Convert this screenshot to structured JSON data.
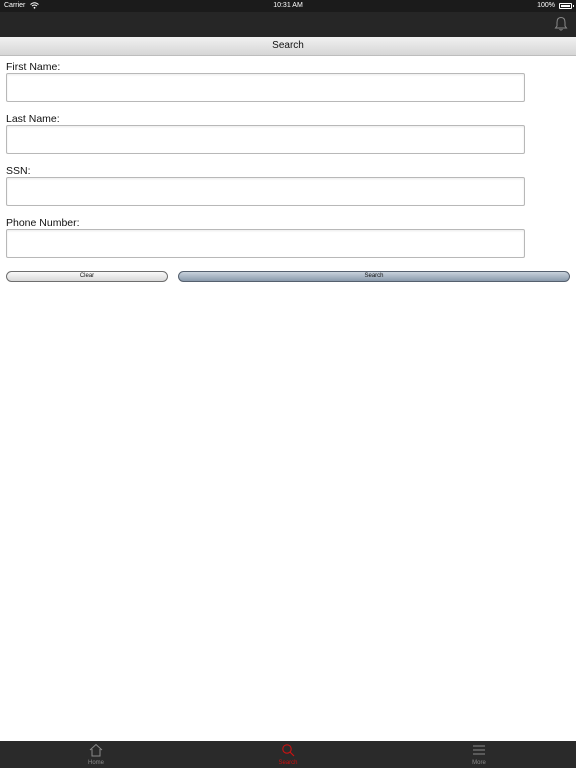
{
  "status_bar": {
    "carrier": "Carrier",
    "time": "10:31 AM",
    "battery_pct": "100%"
  },
  "header": {
    "title": "Search",
    "notification_icon": "bell-icon"
  },
  "form": {
    "first_name_label": "First Name:",
    "first_name_value": "",
    "last_name_label": "Last Name:",
    "last_name_value": "",
    "ssn_label": "SSN:",
    "ssn_value": "",
    "phone_label": "Phone Number:",
    "phone_value": "",
    "clear_label": "Clear",
    "search_label": "Search"
  },
  "tab_bar": {
    "tabs": [
      {
        "label": "Home",
        "icon": "home-icon",
        "active": false
      },
      {
        "label": "Search",
        "icon": "search-icon",
        "active": true
      },
      {
        "label": "More",
        "icon": "menu-icon",
        "active": false
      }
    ],
    "active_color": "#cc1111",
    "inactive_color": "#8a8a8a"
  }
}
